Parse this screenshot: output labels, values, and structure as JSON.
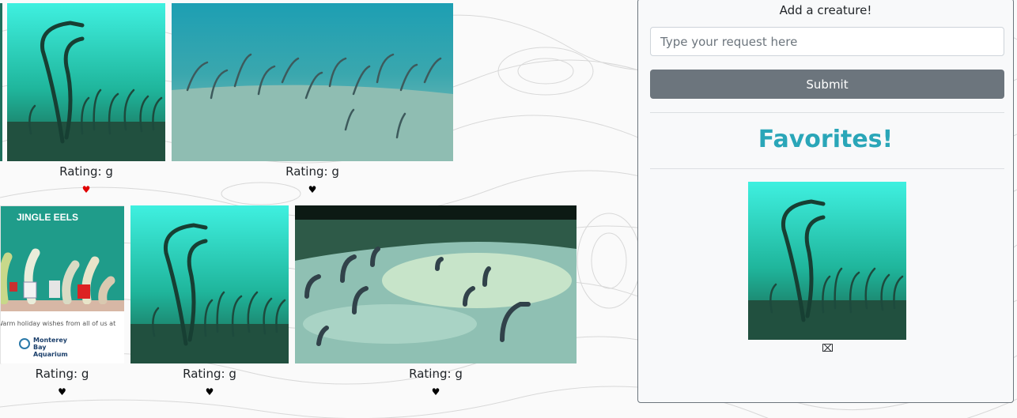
{
  "gifs": [
    {
      "id": "gif-1",
      "rating": "Rating: g",
      "liked": true
    },
    {
      "id": "gif-2",
      "rating": "Rating: g",
      "liked": false
    },
    {
      "id": "gif-3",
      "rating": "Rating: g",
      "liked": false,
      "banner_title": "JINGLE EELS",
      "banner_text": "Warm holiday wishes from all of us at",
      "brand": "Monterey Bay Aquarium"
    },
    {
      "id": "gif-4",
      "rating": "Rating: g",
      "liked": false
    },
    {
      "id": "gif-5",
      "rating": "Rating: g",
      "liked": false
    }
  ],
  "panel": {
    "title": "Add a creature!",
    "input_placeholder": "Type your request here",
    "input_value": "",
    "submit_label": "Submit",
    "favorites_title": "Favorites!",
    "remove_icon": "⌧"
  },
  "icons": {
    "heart": "♥"
  },
  "colors": {
    "accent": "#2aa6b8",
    "button": "#6c757d",
    "heart_liked": "#e00000"
  }
}
